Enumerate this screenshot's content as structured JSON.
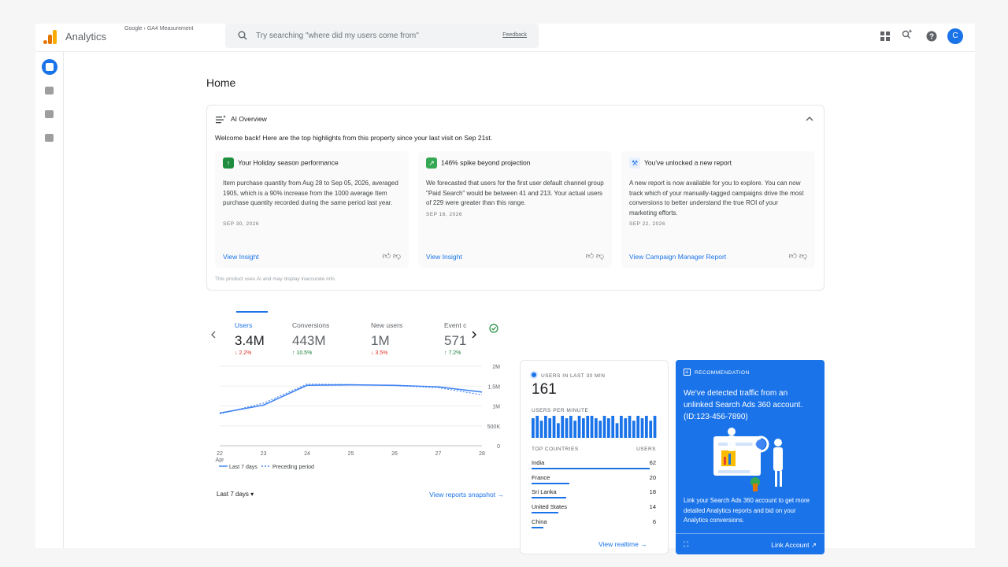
{
  "topbar": {
    "brand": "Analytics",
    "crumb_parent": "Google",
    "crumb_current": "GA4 Measurement",
    "search_placeholder": "Try searching \"where did my users come from\"",
    "feedback": "Feedback",
    "avatar_letter": "C"
  },
  "page": {
    "title": "Home"
  },
  "ai_overview": {
    "title": "AI Overview",
    "welcome": "Welcome back! Here are the top highlights from this property since your last visit on Sep 21st.",
    "disclaimer": "This product uses AI and may display inaccurate info.",
    "cards": [
      {
        "title": "Your Holiday season performance",
        "body": "Item purchase quantity from Aug 28 to Sep 05, 2026, averaged 1905, which is a 90% increase from the 1000 average Item purchase quantity recorded during the same period last year.",
        "date": "SEP 30, 2026",
        "link": "View Insight",
        "badge_color": "#1e8e3e"
      },
      {
        "title": "146% spike beyond projection",
        "body": "We forecasted that users for the first user default channel group \"Paid Search\" would be between 41 and 213. Your actual users of 229 were greater than this range.",
        "date": "SEP 16, 2026",
        "link": "View Insight",
        "badge_color": "#34a853"
      },
      {
        "title": "You've unlocked a new report",
        "body": "A new report is now available for you to explore. You can now track which of your manually-tagged campaigns drive the most conversions to better understand the true ROI of your marketing efforts.",
        "date": "SEP 22, 2026",
        "link": "View Campaign Manager Report",
        "badge_color": "#e8f0fe"
      }
    ]
  },
  "metrics": {
    "tabs": [
      {
        "label": "Users",
        "value": "3.4M",
        "change": "2.2%",
        "dir": "down"
      },
      {
        "label": "Conversions",
        "value": "443M",
        "change": "10.5%",
        "dir": "up"
      },
      {
        "label": "New users",
        "value": "1M",
        "change": "3.5%",
        "dir": "down"
      },
      {
        "label": "Event c",
        "value": "571",
        "change": "7.2%",
        "dir": "up"
      }
    ],
    "range_label": "Last 7 days",
    "view_link": "View reports snapshot"
  },
  "chart_data": {
    "type": "line",
    "x": [
      "22",
      "23",
      "24",
      "25",
      "26",
      "27",
      "28"
    ],
    "x_sub": "Apr",
    "yticks": [
      "0",
      "500K",
      "1M",
      "1.5M",
      "2M"
    ],
    "ylim": [
      0,
      2000000
    ],
    "series": [
      {
        "name": "Last 7 days",
        "values": [
          820000,
          1020000,
          1520000,
          1530000,
          1520000,
          1480000,
          1350000
        ]
      },
      {
        "name": "Preceding period",
        "values": [
          800000,
          1070000,
          1550000,
          1540000,
          1510000,
          1460000,
          1280000
        ]
      }
    ]
  },
  "realtime": {
    "title": "USERS IN LAST 30 MIN",
    "value": "161",
    "per_minute": "USERS PER MINUTE",
    "per_minute_values": [
      8,
      9,
      7,
      9,
      8,
      9,
      6,
      9,
      8,
      9,
      7,
      9,
      8,
      9,
      9,
      8,
      7,
      9,
      8,
      9,
      6,
      9,
      8,
      9,
      7,
      9,
      8,
      9,
      7,
      9
    ],
    "countries_header": "TOP COUNTRIES",
    "users_header": "USERS",
    "countries": [
      {
        "name": "India",
        "users": "62",
        "value": 62
      },
      {
        "name": "France",
        "users": "20",
        "value": 20
      },
      {
        "name": "Sri Lanka",
        "users": "18",
        "value": 18
      },
      {
        "name": "United States",
        "users": "14",
        "value": 14
      },
      {
        "name": "China",
        "users": "6",
        "value": 6
      }
    ],
    "link": "View realtime"
  },
  "recommendation": {
    "label": "RECOMMENDATION",
    "headline": "We've detected traffic from an unlinked Search Ads 360 account. (ID:123-456-7890)",
    "body": "Link your Search Ads 360 account to get more detailed Analytics reports and bid on your Analytics conversions.",
    "link": "Link Account"
  }
}
